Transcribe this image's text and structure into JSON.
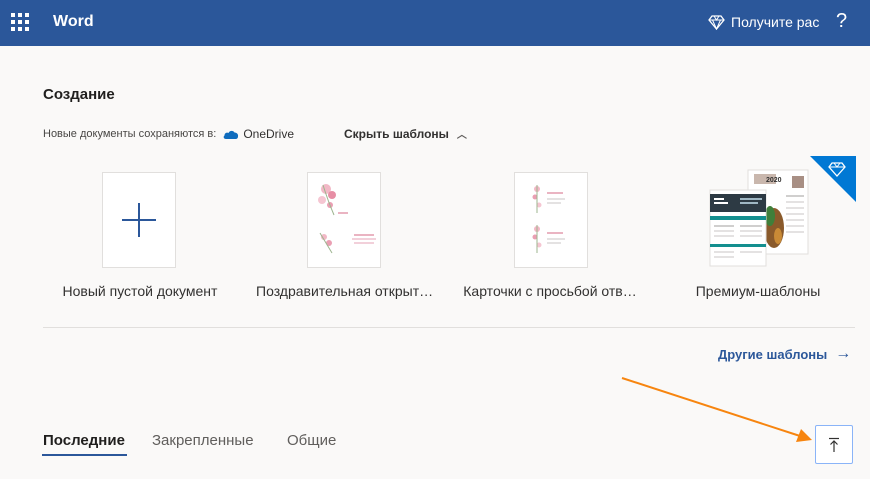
{
  "header": {
    "app_name": "Word",
    "premium_label": "Получите рас",
    "help_label": "?",
    "background": "#2b579a"
  },
  "create": {
    "title": "Создание",
    "save_prefix": "Новые документы сохраняются в:",
    "save_location": "OneDrive",
    "hide_templates": "Скрыть шаблоны",
    "templates": [
      {
        "label": "Новый пустой документ"
      },
      {
        "label": "Поздравительная открыт…"
      },
      {
        "label": "Карточки с просьбой отв…"
      },
      {
        "label": "Премиум-шаблоны"
      }
    ],
    "more_templates": "Другие шаблоны"
  },
  "tabs": [
    {
      "label": "Последние",
      "active": true
    },
    {
      "label": "Закрепленные",
      "active": false
    },
    {
      "label": "Общие",
      "active": false
    }
  ],
  "icons": {
    "waffle": "app-launcher-icon",
    "diamond": "diamond-icon",
    "cloud": "onedrive-cloud-icon",
    "scroll_top": "scroll-to-top-icon"
  },
  "colors": {
    "accent": "#2b579a",
    "annotation_arrow": "#f7850f",
    "premium_badge": "#0078d4"
  },
  "resume": {
    "year": "2020"
  }
}
